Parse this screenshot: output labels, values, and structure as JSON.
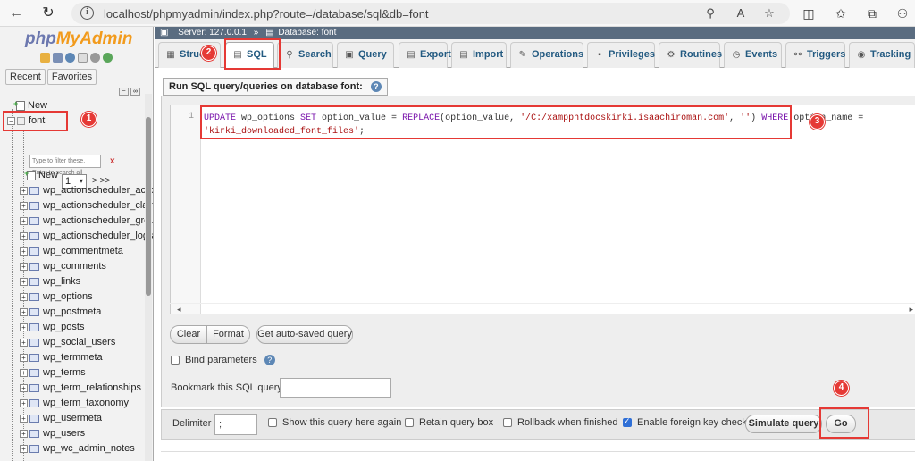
{
  "browser": {
    "url": "localhost/phpmyadmin/index.php?route=/database/sql&db=font"
  },
  "sidebar": {
    "logo_php": "php",
    "logo_rest": "MyAdmin",
    "tabs": [
      "Recent",
      "Favorites"
    ],
    "new_label": "New",
    "db_name": "font",
    "filter_placeholder": "Type to filter these, Enter to search all",
    "filter_clear": "x",
    "page_value": "1",
    "page_next": "> >>",
    "db_new_label": "New",
    "tables": [
      "wp_actionscheduler_actions",
      "wp_actionscheduler_claims",
      "wp_actionscheduler_groups",
      "wp_actionscheduler_logs",
      "wp_commentmeta",
      "wp_comments",
      "wp_links",
      "wp_options",
      "wp_postmeta",
      "wp_posts",
      "wp_social_users",
      "wp_termmeta",
      "wp_terms",
      "wp_term_relationships",
      "wp_term_taxonomy",
      "wp_usermeta",
      "wp_users",
      "wp_wc_admin_notes"
    ]
  },
  "breadcrumb": {
    "server": "Server: 127.0.0.1",
    "sep": "»",
    "database": "Database: font"
  },
  "tabs": [
    {
      "label": "Struc",
      "icon": "structure-icon"
    },
    {
      "label": "SQL",
      "icon": "sql-icon"
    },
    {
      "label": "Search",
      "icon": "search-icon"
    },
    {
      "label": "Query",
      "icon": "query-icon"
    },
    {
      "label": "Export",
      "icon": "export-icon"
    },
    {
      "label": "Import",
      "icon": "import-icon"
    },
    {
      "label": "Operations",
      "icon": "wrench-icon"
    },
    {
      "label": "Privileges",
      "icon": "privileges-icon"
    },
    {
      "label": "Routines",
      "icon": "routines-icon"
    },
    {
      "label": "Events",
      "icon": "clock-icon"
    },
    {
      "label": "Triggers",
      "icon": "triggers-icon"
    },
    {
      "label": "Tracking",
      "icon": "eye-icon"
    }
  ],
  "sql_panel": {
    "title": "Run SQL query/queries on database font:",
    "line_number": "1",
    "query": {
      "kw1": "UPDATE",
      "t1": " wp_options ",
      "kw2": "SET",
      "t2": " option_value = ",
      "fn": "REPLACE",
      "t3": "(option_value, ",
      "s1": "'/C:/xampphtdocskirki.isaachiroman.com'",
      "t4": ", ",
      "s2": "''",
      "t5": ") ",
      "kw3": "WHERE",
      "t6": " option_name = ",
      "s3": "'kirki_downloaded_font_files'",
      "t7": ";"
    },
    "buttons": {
      "clear": "Clear",
      "format": "Format",
      "autosaved": "Get auto-saved query"
    },
    "bind_parameters": "Bind parameters",
    "bookmark_label": "Bookmark this SQL query:",
    "bookmark_value": ""
  },
  "bottom_bar": {
    "delimiter_label": "Delimiter",
    "delimiter_value": ";",
    "show_query": "Show this query here again",
    "retain_box": "Retain query box",
    "rollback": "Rollback when finished",
    "foreign_keys": "Enable foreign key checks",
    "simulate": "Simulate query",
    "go": "Go"
  },
  "annotations": [
    "1",
    "2",
    "3",
    "4"
  ],
  "colors": {
    "annotation_red": "#e53935",
    "breadcrumb_bg": "#5a6c80",
    "tab_text": "#235a81"
  }
}
